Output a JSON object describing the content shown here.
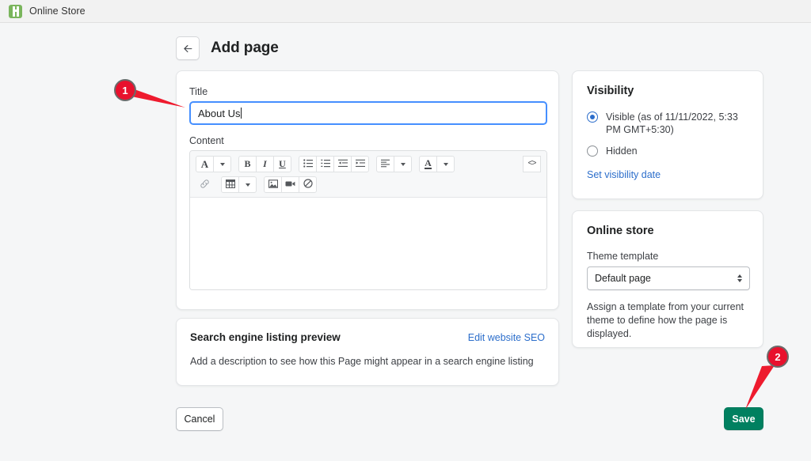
{
  "topbar": {
    "logo_icon": "online-store-logo-icon",
    "title": "Online Store"
  },
  "header": {
    "back_icon": "arrow-left-icon",
    "title": "Add page"
  },
  "main_card": {
    "title_label": "Title",
    "title_value": "About Us",
    "title_placeholder": "",
    "content_label": "Content",
    "content_value": "",
    "toolbar": {
      "row1": [
        {
          "name": "font-style-dropdown",
          "glyph": "A",
          "caret": true
        },
        {
          "name": "bold-button",
          "glyph": "B",
          "caret": false
        },
        {
          "name": "italic-button",
          "glyph": "I",
          "caret": false
        },
        {
          "name": "underline-button",
          "glyph": "U",
          "caret": false
        },
        {
          "name": "bulleted-list-button",
          "glyph": "list-bulleted-icon",
          "caret": false
        },
        {
          "name": "numbered-list-button",
          "glyph": "list-numbered-icon",
          "caret": false
        },
        {
          "name": "outdent-button",
          "glyph": "outdent-icon",
          "caret": false
        },
        {
          "name": "indent-button",
          "glyph": "indent-icon",
          "caret": false
        },
        {
          "name": "align-dropdown",
          "glyph": "align-left-icon",
          "caret": true
        },
        {
          "name": "text-color-dropdown",
          "glyph": "A-underline",
          "caret": true
        }
      ],
      "code_view_label": "<>",
      "row2": [
        {
          "name": "insert-link-button",
          "glyph": "link-icon",
          "caret": false
        },
        {
          "name": "insert-table-dropdown",
          "glyph": "table-icon",
          "caret": true
        },
        {
          "name": "insert-image-button",
          "glyph": "image-icon",
          "caret": false
        },
        {
          "name": "insert-video-button",
          "glyph": "video-icon",
          "caret": false
        },
        {
          "name": "clear-formatting-button",
          "glyph": "no-entry-icon",
          "caret": false
        }
      ]
    }
  },
  "seo_card": {
    "title": "Search engine listing preview",
    "edit_link": "Edit website SEO",
    "description": "Add a description to see how this Page might appear in a search engine listing"
  },
  "visibility_card": {
    "title": "Visibility",
    "options": [
      {
        "label": "Visible (as of 11/11/2022, 5:33 PM GMT+5:30)",
        "selected": true
      },
      {
        "label": "Hidden",
        "selected": false
      }
    ],
    "visible_label": "Visible (as of 11/11/2022, 5:33 PM GMT+5:30)",
    "hidden_label": "Hidden",
    "set_date_link": "Set visibility date"
  },
  "online_store_card": {
    "title": "Online store",
    "template_label": "Theme template",
    "template_value": "Default page",
    "template_options": [
      "Default page"
    ],
    "helper_text": "Assign a template from your current theme to define how the page is displayed."
  },
  "footer": {
    "cancel_label": "Cancel",
    "save_label": "Save"
  },
  "annotations": {
    "marker_1": "1",
    "marker_2": "2",
    "color": "#e8112d"
  }
}
